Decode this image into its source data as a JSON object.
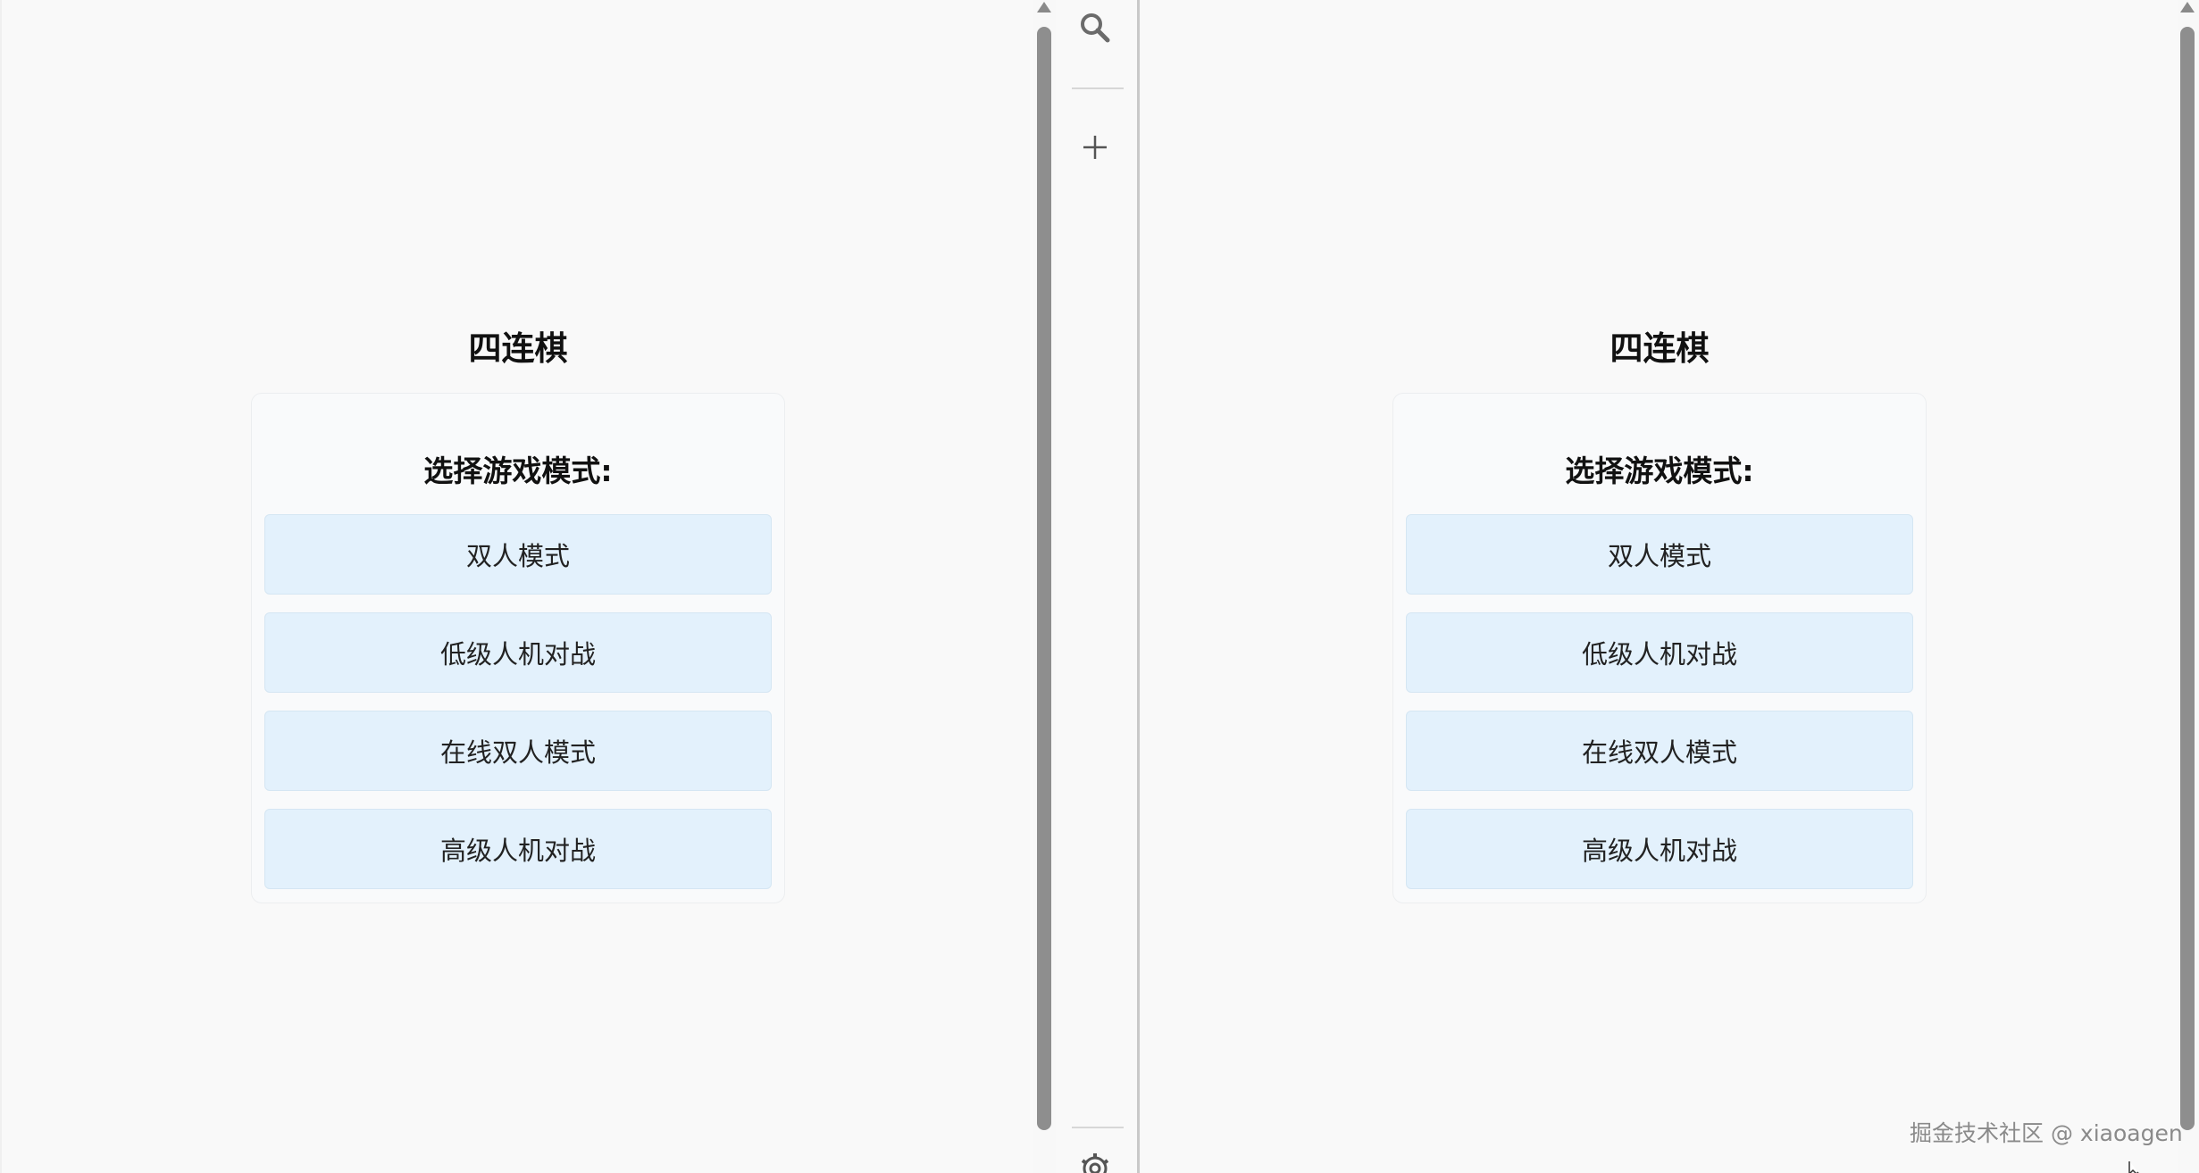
{
  "panes": {
    "left": {
      "game_title": "四连棋",
      "menu_heading": "选择游戏模式:",
      "modes": [
        "双人模式",
        "低级人机对战",
        "在线双人模式",
        "高级人机对战"
      ]
    },
    "right": {
      "game_title": "四连棋",
      "menu_heading": "选择游戏模式:",
      "modes": [
        "双人模式",
        "低级人机对战",
        "在线双人模式",
        "高级人机对战"
      ]
    }
  },
  "sidebar": {
    "icons": [
      "search-icon",
      "plus-icon",
      "gear-icon"
    ]
  },
  "watermark": "掘金技术社区 @ xiaoagen",
  "colors": {
    "button_bg": "#e3f1fc",
    "background": "#f9f9f9",
    "scrollbar": "#8e8e8e"
  }
}
